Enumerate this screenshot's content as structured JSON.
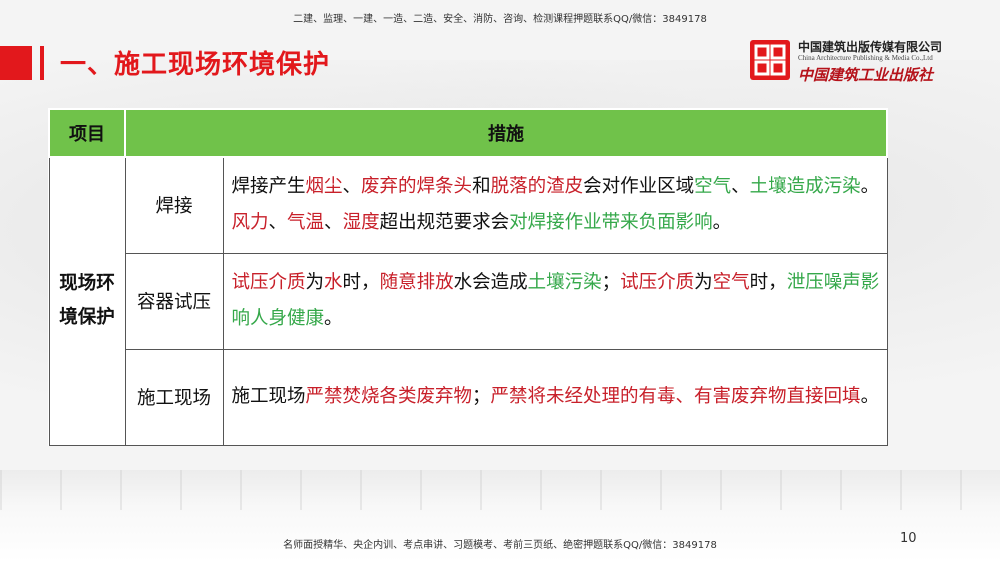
{
  "header_note": "二建、监理、一建、一造、二造、安全、消防、咨询、检测课程押题联系QQ/微信：3849178",
  "footer_note": "名师面授精华、央企内训、考点串讲、习题模考、考前三页纸、绝密押题联系QQ/微信：3849178",
  "page_number": "10",
  "title": "一、施工现场环境保护",
  "logo": {
    "name_cn": "中国建筑出版传媒有限公司",
    "name_en": "China Architecture Publishing & Media Co.,Ltd",
    "calligraphy": "中国建筑工业出版社"
  },
  "colors": {
    "title_red": "#e2181c",
    "header_green": "#70c24a",
    "text_red": "#c8202a",
    "text_green": "#35a84a"
  },
  "table": {
    "headers": {
      "item": "项目",
      "measures": "措施"
    },
    "category": "现场环境保护",
    "rows": [
      {
        "sub": "焊接",
        "segments": [
          {
            "t": "焊接产生",
            "c": "k"
          },
          {
            "t": "烟尘",
            "c": "r"
          },
          {
            "t": "、",
            "c": "k"
          },
          {
            "t": "废弃的焊条头",
            "c": "r"
          },
          {
            "t": "和",
            "c": "k"
          },
          {
            "t": "脱落的渣皮",
            "c": "r"
          },
          {
            "t": "会对作业区域",
            "c": "k"
          },
          {
            "t": "空气",
            "c": "g"
          },
          {
            "t": "、",
            "c": "k"
          },
          {
            "t": "土壤造成污染",
            "c": "g"
          },
          {
            "t": "。",
            "c": "k"
          },
          {
            "t": "风力",
            "c": "r"
          },
          {
            "t": "、",
            "c": "k"
          },
          {
            "t": "气温",
            "c": "r"
          },
          {
            "t": "、",
            "c": "k"
          },
          {
            "t": "湿度",
            "c": "r"
          },
          {
            "t": "超出规范要求会",
            "c": "k"
          },
          {
            "t": "对焊接作业带来负面影响",
            "c": "g"
          },
          {
            "t": "。",
            "c": "k"
          }
        ]
      },
      {
        "sub": "容器试压",
        "segments": [
          {
            "t": "试压介质",
            "c": "r"
          },
          {
            "t": "为",
            "c": "k"
          },
          {
            "t": "水",
            "c": "r"
          },
          {
            "t": "时，",
            "c": "k"
          },
          {
            "t": "随意排放",
            "c": "r"
          },
          {
            "t": "水会造成",
            "c": "k"
          },
          {
            "t": "土壤污染",
            "c": "g"
          },
          {
            "t": "；",
            "c": "k"
          },
          {
            "t": "试压介质",
            "c": "r"
          },
          {
            "t": "为",
            "c": "k"
          },
          {
            "t": "空气",
            "c": "r"
          },
          {
            "t": "时，",
            "c": "k"
          },
          {
            "t": "泄压噪声影响人身健康",
            "c": "g"
          },
          {
            "t": "。",
            "c": "k"
          }
        ]
      },
      {
        "sub": "施工现场",
        "segments": [
          {
            "t": "施工现场",
            "c": "k"
          },
          {
            "t": "严禁焚烧各类废弃物",
            "c": "r"
          },
          {
            "t": "；",
            "c": "k"
          },
          {
            "t": "严禁将未经处理的有毒、有害废弃物直接回填",
            "c": "r"
          },
          {
            "t": "。",
            "c": "k"
          }
        ]
      }
    ]
  }
}
